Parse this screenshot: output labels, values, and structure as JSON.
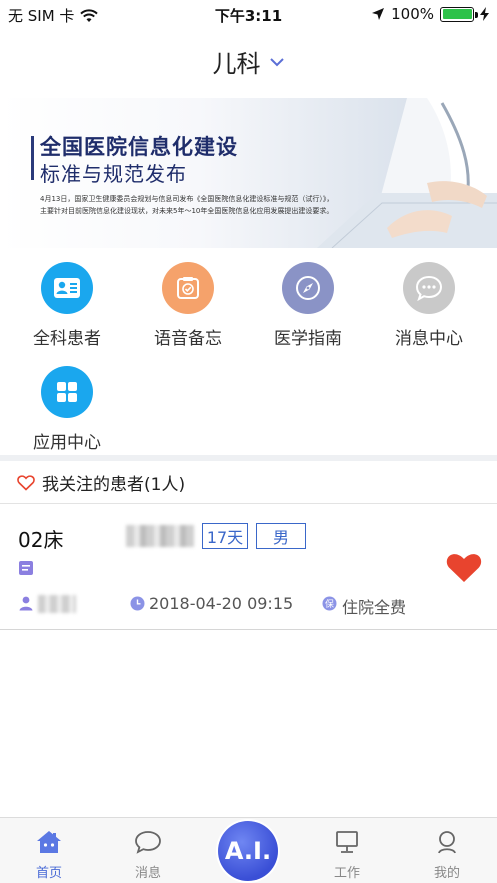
{
  "status_bar": {
    "carrier": "无 SIM 卡",
    "time": "下午3:11",
    "battery": "100%",
    "battery_level": 1.0,
    "icons": [
      "wifi-icon",
      "location-arrow-icon",
      "battery-icon",
      "charging-icon"
    ]
  },
  "header": {
    "title": "儿科",
    "dropdown_icon": "chevron-down-icon"
  },
  "banner": {
    "headline1": "全国医院信息化建设",
    "headline2": "标准与规范发布",
    "body_line1": "4月13日，国家卫生健康委员会规划与信息司发布《全国医院信息化建设标准与规范（试行）》，",
    "body_line2": "主要针对目前医院信息化建设现状，对未来5年～10年全国医院信息化应用发展提出建设要求。"
  },
  "quick_actions": [
    {
      "label": "全科患者",
      "icon": "patient-card-icon",
      "color": "#1aa7ee"
    },
    {
      "label": "语音备忘",
      "icon": "memo-check-icon",
      "color": "#f5a26b"
    },
    {
      "label": "医学指南",
      "icon": "compass-icon",
      "color": "#8a93c6"
    },
    {
      "label": "消息中心",
      "icon": "chat-bubble-icon",
      "color": "#c9c9c9"
    },
    {
      "label": "应用中心",
      "icon": "apps-grid-icon",
      "color": "#1aa7ee"
    }
  ],
  "followed": {
    "title": "我关注的患者(1人)",
    "icon": "heart-outline-icon",
    "patients": [
      {
        "bed": "02床",
        "days": "17天",
        "sex": "男",
        "admit_time": "2018-04-20 09:15",
        "fee_type": "住院全费",
        "favorite_icon": "heart-filled-icon"
      }
    ]
  },
  "tabbar": {
    "tabs": [
      {
        "label": "首页",
        "icon": "home-icon",
        "active": true
      },
      {
        "label": "消息",
        "icon": "message-icon",
        "active": false
      },
      {
        "label": "工作",
        "icon": "monitor-icon",
        "active": false
      },
      {
        "label": "我的",
        "icon": "profile-icon",
        "active": false
      }
    ],
    "ai_label": "A.I."
  },
  "colors": {
    "accent": "#4a6bd6",
    "tag_border": "#3a67c9",
    "heart": "#e8442e"
  }
}
